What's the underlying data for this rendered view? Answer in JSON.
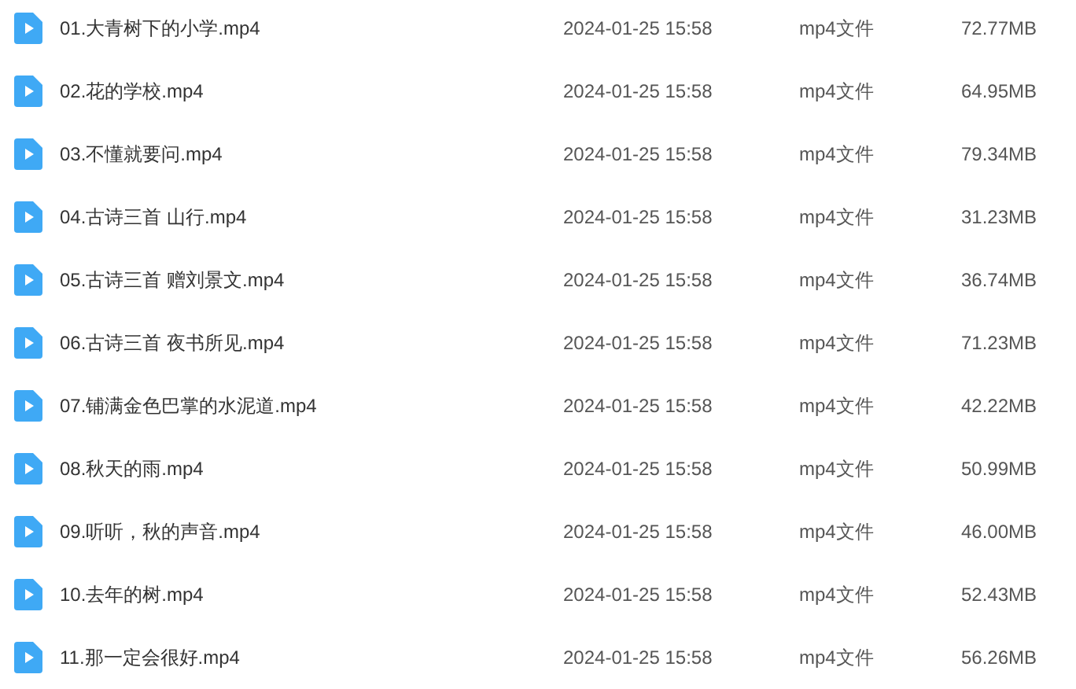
{
  "files": [
    {
      "name": "01.大青树下的小学.mp4",
      "modified": "2024-01-25 15:58",
      "type": "mp4文件",
      "size": "72.77MB"
    },
    {
      "name": "02.花的学校.mp4",
      "modified": "2024-01-25 15:58",
      "type": "mp4文件",
      "size": "64.95MB"
    },
    {
      "name": "03.不懂就要问.mp4",
      "modified": "2024-01-25 15:58",
      "type": "mp4文件",
      "size": "79.34MB"
    },
    {
      "name": "04.古诗三首 山行.mp4",
      "modified": "2024-01-25 15:58",
      "type": "mp4文件",
      "size": "31.23MB"
    },
    {
      "name": "05.古诗三首 赠刘景文.mp4",
      "modified": "2024-01-25 15:58",
      "type": "mp4文件",
      "size": "36.74MB"
    },
    {
      "name": "06.古诗三首 夜书所见.mp4",
      "modified": "2024-01-25 15:58",
      "type": "mp4文件",
      "size": "71.23MB"
    },
    {
      "name": "07.铺满金色巴掌的水泥道.mp4",
      "modified": "2024-01-25 15:58",
      "type": "mp4文件",
      "size": "42.22MB"
    },
    {
      "name": "08.秋天的雨.mp4",
      "modified": "2024-01-25 15:58",
      "type": "mp4文件",
      "size": "50.99MB"
    },
    {
      "name": "09.听听，秋的声音.mp4",
      "modified": "2024-01-25 15:58",
      "type": "mp4文件",
      "size": "46.00MB"
    },
    {
      "name": "10.去年的树.mp4",
      "modified": "2024-01-25 15:58",
      "type": "mp4文件",
      "size": "52.43MB"
    },
    {
      "name": "11.那一定会很好.mp4",
      "modified": "2024-01-25 15:58",
      "type": "mp4文件",
      "size": "56.26MB"
    }
  ]
}
